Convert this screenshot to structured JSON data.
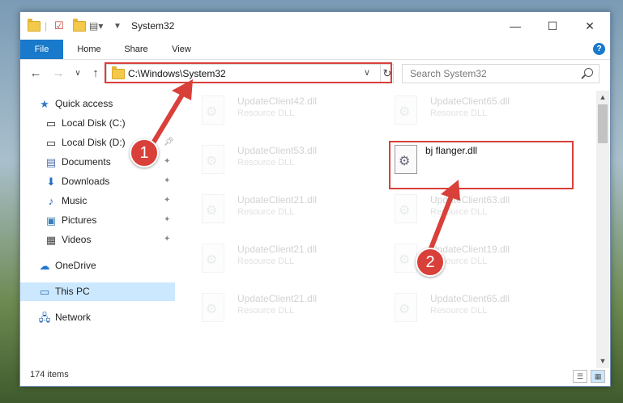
{
  "window": {
    "title": "System32",
    "controls": {
      "minimize": "—",
      "maximize": "☐",
      "close": "✕"
    }
  },
  "ribbon": {
    "tabs": [
      {
        "label": "File"
      },
      {
        "label": "Home"
      },
      {
        "label": "Share"
      },
      {
        "label": "View"
      }
    ],
    "help": "?"
  },
  "address": {
    "path": "C:\\Windows\\System32",
    "search_placeholder": "Search System32"
  },
  "sidebar": {
    "quick_access": "Quick access",
    "items": [
      {
        "label": "Local Disk (C:)",
        "icon": "drive-icon"
      },
      {
        "label": "Local Disk (D:)",
        "icon": "drive-icon"
      },
      {
        "label": "Documents",
        "icon": "documents-icon"
      },
      {
        "label": "Downloads",
        "icon": "downloads-icon"
      },
      {
        "label": "Music",
        "icon": "music-icon"
      },
      {
        "label": "Pictures",
        "icon": "pictures-icon"
      },
      {
        "label": "Videos",
        "icon": "videos-icon"
      }
    ],
    "onedrive": "OneDrive",
    "this_pc": "This PC",
    "network": "Network"
  },
  "files": {
    "col1": [
      {
        "name": "UpdateClient42.dll",
        "type": "Resource DLL"
      },
      {
        "name": "UpdateClient53.dll",
        "type": "Resource DLL"
      },
      {
        "name": "UpdateClient21.dll",
        "type": "Resource DLL"
      },
      {
        "name": "UpdateClient21.dll",
        "type": "Resource DLL"
      },
      {
        "name": "UpdateClient21.dll",
        "type": "Resource DLL"
      }
    ],
    "col2": [
      {
        "name": "UpdateClient65.dll",
        "type": "Resource DLL"
      },
      {
        "name": "bj flanger.dll",
        "type": ""
      },
      {
        "name": "UpdateClient63.dll",
        "type": "Resource DLL"
      },
      {
        "name": "UpdateClient19.dll",
        "type": "Resource DLL"
      },
      {
        "name": "UpdateClient65.dll",
        "type": "Resource DLL"
      }
    ]
  },
  "status": {
    "count": "174 items"
  },
  "annotations": {
    "marker1": "1",
    "marker2": "2",
    "color": "#d9403a"
  }
}
